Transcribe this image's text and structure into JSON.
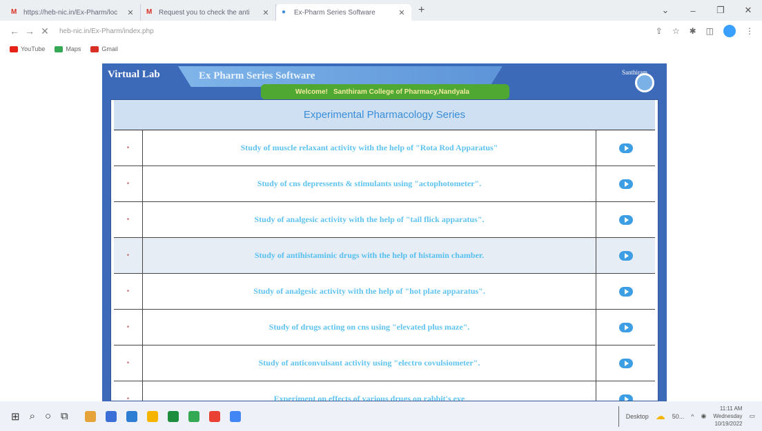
{
  "browser": {
    "tabs": [
      {
        "icon": "gmail-icon",
        "title": "https://heb-nic.in/Ex-Pharm/loc"
      },
      {
        "icon": "gmail-icon",
        "title": "Request you to check the anti"
      },
      {
        "icon": "globe-icon",
        "title": "Ex-Pharm Series Software"
      }
    ],
    "new_tab": "+",
    "url": "heb-nic.in/Ex-Pharm/index.php",
    "bookmarks": [
      {
        "label": "YouTube",
        "color": "#e62117"
      },
      {
        "label": "Maps",
        "color": "#34a853"
      },
      {
        "label": "Gmail",
        "color": "#d93025"
      }
    ]
  },
  "lab": {
    "brand": "Virtual Lab",
    "title": "Ex Pharm Series Software",
    "welcome_label": "Welcome!",
    "welcome_college": "Santhiram College of Pharmacy,Nandyala",
    "user": "Santhiram",
    "series_title": "Experimental Pharmacology Series",
    "experiments": [
      {
        "num": "•",
        "title": "Study of muscle relaxant activity with the help of \"Rota Rod Apparatus\"",
        "highlighted": false
      },
      {
        "num": "•",
        "title": "Study of cns depressents & stimulants using \"actophotometer\".",
        "highlighted": false
      },
      {
        "num": "•",
        "title": "Study of analgesic activity with the help of \"tail flick apparatus\".",
        "highlighted": false
      },
      {
        "num": "•",
        "title": "Study of antihistaminic drugs with the help of histamin chamber.",
        "highlighted": true
      },
      {
        "num": "•",
        "title": "Study of analgesic activity with the help of \"hot plate apparatus\".",
        "highlighted": false
      },
      {
        "num": "•",
        "title": "Study of drugs acting on cns using \"elevated plus maze\".",
        "highlighted": false
      },
      {
        "num": "•",
        "title": "Study of anticonvulsant activity using \"electro covulsiometer\".",
        "highlighted": false
      },
      {
        "num": "•",
        "title": "Experiment on effects of various drugs on rabbit's eye",
        "highlighted": false
      }
    ]
  },
  "taskbar": {
    "desktop_label": "Desktop",
    "app_chip": "50...",
    "time": "11:11 AM",
    "day": "Wednesday",
    "date": "10/19/2022"
  },
  "colors": {
    "lab_blue": "#3c69b8",
    "welcome_green": "#4ea832",
    "link_cyan": "#5fc3f0"
  }
}
